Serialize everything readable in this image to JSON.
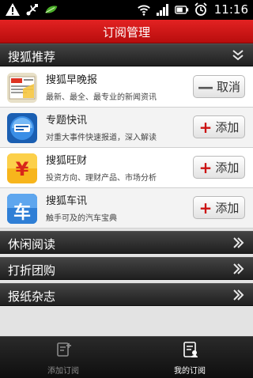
{
  "status_bar": {
    "time": "11:16"
  },
  "header": {
    "title": "订阅管理"
  },
  "sections": {
    "recommend": {
      "label": "搜狐推荐"
    },
    "leisure": {
      "label": "休闲阅读"
    },
    "discount": {
      "label": "打折团购"
    },
    "newspaper": {
      "label": "报纸杂志"
    }
  },
  "subscriptions": [
    {
      "name": "搜狐早晚报",
      "desc": "最新、最全、最专业的新闻资讯",
      "action": "取消",
      "action_symbol": "—",
      "icon": "newspaper-icon"
    },
    {
      "name": "专题快讯",
      "desc": "对重大事件快速报道，深入解读",
      "action": "添加",
      "action_symbol": "+",
      "icon": "special-report-icon"
    },
    {
      "name": "搜狐旺财",
      "desc": "投资方向、理财产品、市场分析",
      "action": "添加",
      "action_symbol": "+",
      "icon": "finance-icon"
    },
    {
      "name": "搜狐车讯",
      "desc": "触手可及的汽车宝典",
      "action": "添加",
      "action_symbol": "+",
      "icon": "car-icon"
    }
  ],
  "icon_labels": {
    "car": "车"
  },
  "tabs": [
    {
      "label": "添加订阅",
      "active": false
    },
    {
      "label": "我的订阅",
      "active": true
    }
  ],
  "colors": {
    "header_red": "#d41818",
    "add_red": "#cc1212"
  }
}
